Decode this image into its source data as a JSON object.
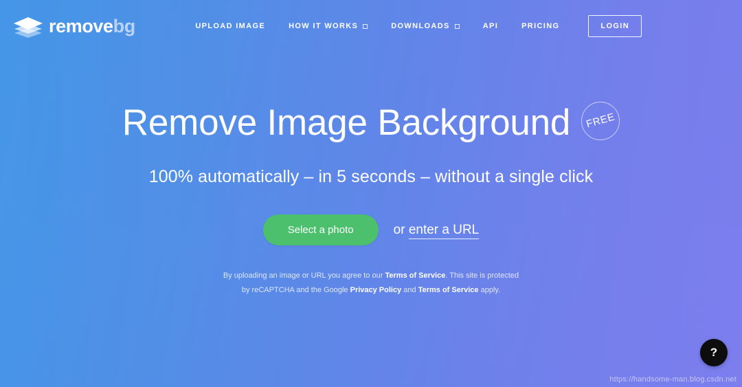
{
  "brand": {
    "logo_icon": "stacked-layers-diamond-icon",
    "name_primary": "remove",
    "name_secondary": "bg"
  },
  "nav": {
    "items": [
      {
        "label": "UPLOAD IMAGE",
        "has_caret": false
      },
      {
        "label": "HOW IT WORKS",
        "has_caret": true
      },
      {
        "label": "DOWNLOADS",
        "has_caret": true
      },
      {
        "label": "API",
        "has_caret": false
      },
      {
        "label": "PRICING",
        "has_caret": false
      }
    ],
    "login_label": "LOGIN"
  },
  "hero": {
    "headline": "Remove Image Background",
    "badge": "FREE",
    "subheadline": "100% automatically – in 5 seconds – without a single click",
    "cta_button": "Select a photo",
    "url_prefix": "or ",
    "url_link": "enter a URL"
  },
  "fineprint": {
    "line1_part1": "By uploading an image or URL you agree to our ",
    "line1_link": "Terms of Service",
    "line1_part2": ". This site is protected",
    "line2_part1": "by reCAPTCHA and the Google ",
    "line2_link1": "Privacy Policy",
    "line2_mid": " and ",
    "line2_link2": "Terms of Service",
    "line2_part2": " apply."
  },
  "help": {
    "icon": "question-mark-icon",
    "label": "?"
  },
  "watermark": "https://handsome-man.blog.csdn.net",
  "colors": {
    "gradient_left": "#4f9ae8",
    "gradient_right": "#7a7fec",
    "cta_green": "#4cc06c",
    "logo_secondary": "#b9d3f6",
    "help_bg": "#0d0d0d"
  }
}
